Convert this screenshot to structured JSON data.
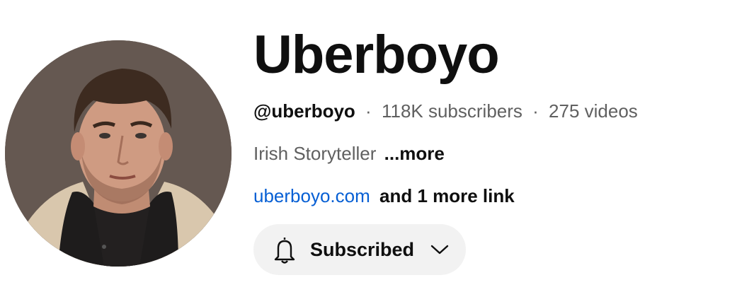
{
  "channel": {
    "name": "Uberboyo",
    "handle": "@uberboyo",
    "separator": "·",
    "subscribers": "118K subscribers",
    "videos": "275 videos",
    "description": "Irish Storyteller",
    "more_label": "...more",
    "link_text": "uberboyo.com",
    "more_links_label": "and 1 more link"
  },
  "subscribe": {
    "label": "Subscribed",
    "icon": "bell-icon",
    "dropdown_icon": "chevron-down-icon"
  },
  "colors": {
    "link": "#065fd4",
    "text_primary": "#0f0f0f",
    "text_secondary": "#606060",
    "button_bg": "#f2f2f2"
  }
}
